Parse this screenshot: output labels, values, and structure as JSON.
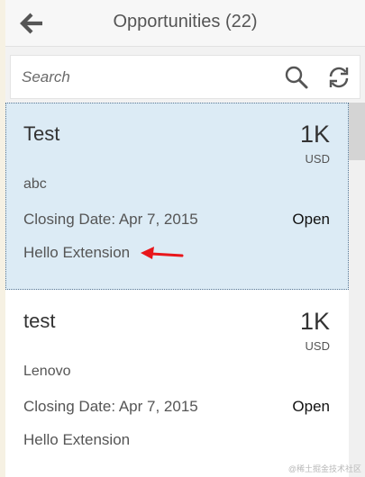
{
  "header": {
    "title": "Opportunities (22)",
    "back_icon": "back-arrow-icon"
  },
  "search": {
    "placeholder": "Search",
    "value": "",
    "search_icon": "search-icon",
    "refresh_icon": "refresh-icon"
  },
  "opportunities": [
    {
      "name": "Test",
      "amount": "1K",
      "currency": "USD",
      "account": "abc",
      "closing_date": "Closing Date: Apr 7, 2015",
      "status": "Open",
      "extension": "Hello Extension",
      "selected": true
    },
    {
      "name": "test",
      "amount": "1K",
      "currency": "USD",
      "account": "Lenovo",
      "closing_date": "Closing Date: Apr 7, 2015",
      "status": "Open",
      "extension": "Hello Extension",
      "selected": false
    }
  ],
  "annotation": {
    "icon": "red-arrow-icon",
    "color": "#e8161b"
  },
  "watermark": "@稀土掘金技术社区",
  "colors": {
    "selected_bg": "#dcebf5",
    "header_bg": "#f7f7f7",
    "arrow": "#e8161b"
  }
}
